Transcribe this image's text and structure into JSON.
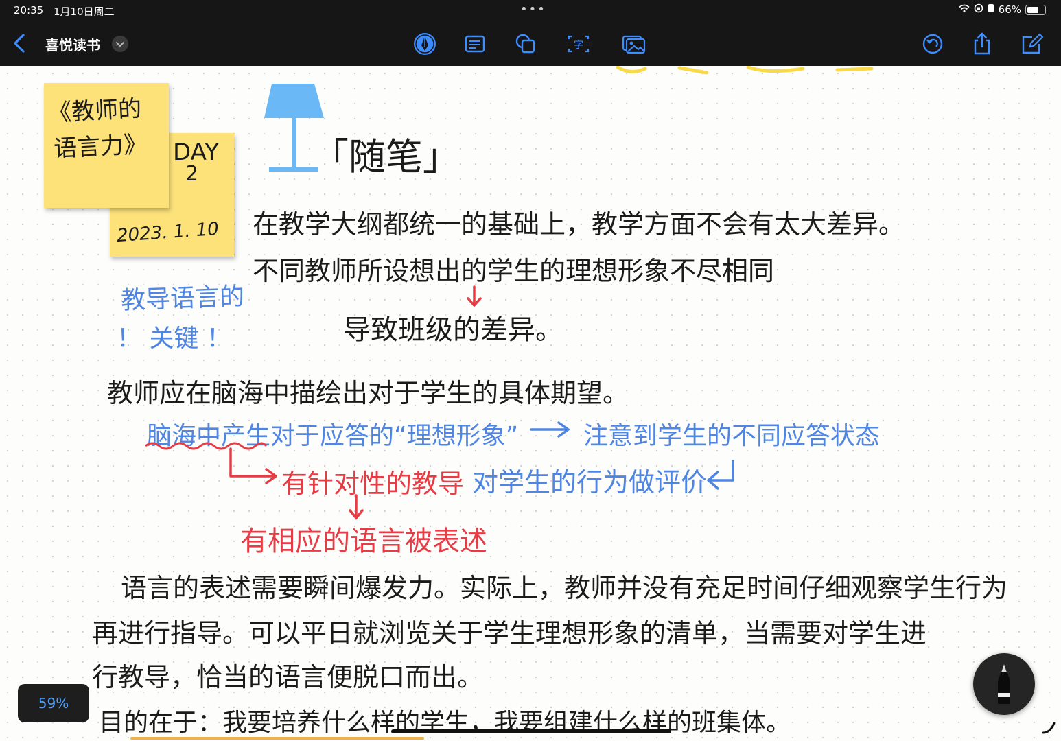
{
  "status": {
    "time": "20:35",
    "date": "1月10日周二",
    "battery": "66%"
  },
  "toolbar": {
    "title": "喜悦读书",
    "icons": [
      "back-chevron-icon",
      "pen-tool-icon",
      "text-box-icon",
      "shapes-icon",
      "text-recognition-icon",
      "image-icon",
      "undo-icon",
      "share-icon",
      "compose-icon"
    ]
  },
  "notes": {
    "book": [
      "《教师的",
      "语言力》"
    ],
    "day": [
      "DAY",
      "2"
    ],
    "date": "2023. 1. 10"
  },
  "handwriting": {
    "heading": "「随笔」",
    "line1": "在教学大纲都统一的基础上，教学方面不会有太大差异。",
    "line2": "不同教师所设想出的学生的理想形象不尽相同",
    "line3": "导致班级的差异。",
    "side_blue": [
      "教导语言的",
      "！ 关键 ！"
    ],
    "line4": "教师应在脑海中描绘出对于学生的具体期望。",
    "blue_line": "脑海中产生对于应答的“理想形象”",
    "blue_arrow_target": "注意到学生的不同应答状态",
    "red1": "有针对性的教导",
    "blue2": "对学生的行为做评价",
    "red2": "有相应的语言被表述",
    "para1": "语言的表述需要瞬间爆发力。实际上，教师并没有充足时间仔细观察学生行为",
    "para2": "再进行指导。可以平日就浏览关于学生理想形象的清单，当需要对学生进",
    "para3": "行教导，恰当的语言便脱口而出。",
    "para4": "目的在于：我要培养什么样的学生，我要组建什么样的班集体。"
  },
  "zoom": "59%"
}
